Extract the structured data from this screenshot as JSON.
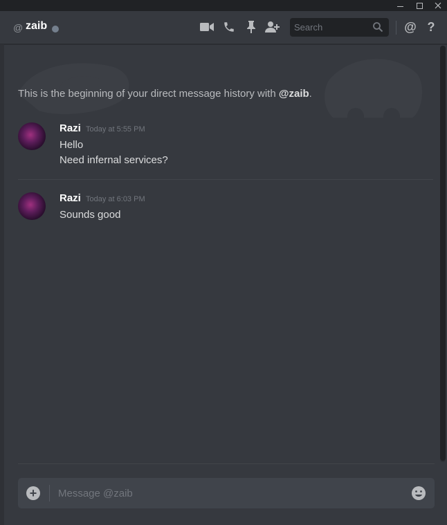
{
  "window": {
    "minimize_icon": "minimize-icon",
    "maximize_icon": "maximize-icon",
    "close_icon": "close-icon"
  },
  "header": {
    "at_symbol": "@",
    "channel_name": "zaib",
    "status": "offline",
    "search_placeholder": "Search",
    "mentions_symbol": "@",
    "help_symbol": "?"
  },
  "intro": {
    "prefix": "This is the beginning of your direct message history with ",
    "handle": "@zaib",
    "suffix": "."
  },
  "messages": [
    {
      "author": "Razi",
      "timestamp": "Today at 5:55 PM",
      "lines": [
        "Hello",
        "Need infernal services?"
      ]
    },
    {
      "author": "Razi",
      "timestamp": "Today at 6:03 PM",
      "lines": [
        "Sounds good"
      ]
    }
  ],
  "composer": {
    "placeholder": "Message @zaib"
  },
  "colors": {
    "background": "#36393f",
    "titlebar": "#202225",
    "composer": "#40444b",
    "status_offline": "#747f8d"
  }
}
